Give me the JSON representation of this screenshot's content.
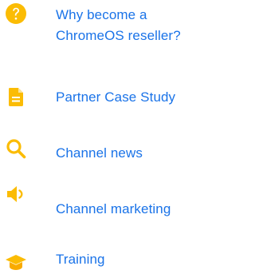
{
  "nav": {
    "items": [
      {
        "label": "Why become a ChromeOS reseller?",
        "icon": "help-circle-icon"
      },
      {
        "label": "Partner Case Study",
        "icon": "document-icon"
      },
      {
        "label": "Channel news",
        "icon": "search-icon"
      },
      {
        "label": "Channel marketing",
        "icon": "speaker-icon"
      },
      {
        "label": "Training",
        "icon": "graduation-cap-icon"
      }
    ]
  },
  "colors": {
    "accent": "#fbbc04",
    "link": "#1a73e8"
  }
}
